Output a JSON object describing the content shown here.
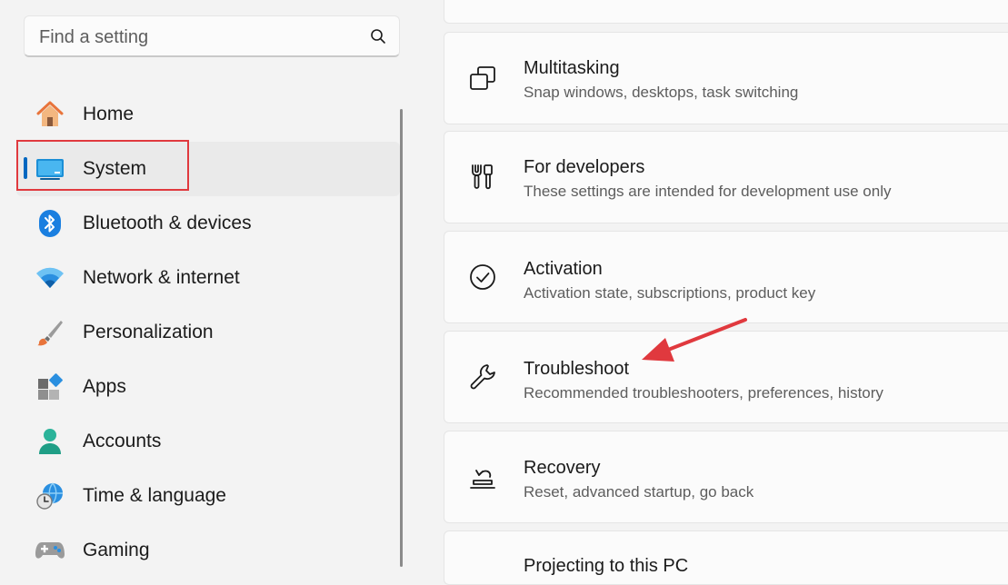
{
  "search": {
    "placeholder": "Find a setting"
  },
  "nav": {
    "items": [
      {
        "label": "Home"
      },
      {
        "label": "System"
      },
      {
        "label": "Bluetooth & devices"
      },
      {
        "label": "Network & internet"
      },
      {
        "label": "Personalization"
      },
      {
        "label": "Apps"
      },
      {
        "label": "Accounts"
      },
      {
        "label": "Time & language"
      },
      {
        "label": "Gaming"
      }
    ],
    "active_index": 1
  },
  "cards": [
    {
      "title": "Multitasking",
      "description": "Snap windows, desktops, task switching",
      "icon": "multitasking-icon"
    },
    {
      "title": "For developers",
      "description": "These settings are intended for development use only",
      "icon": "developer-tools-icon"
    },
    {
      "title": "Activation",
      "description": "Activation state, subscriptions, product key",
      "icon": "checkmark-circle-icon"
    },
    {
      "title": "Troubleshoot",
      "description": "Recommended troubleshooters, preferences, history",
      "icon": "wrench-icon"
    },
    {
      "title": "Recovery",
      "description": "Reset, advanced startup, go back",
      "icon": "recovery-icon"
    },
    {
      "title": "Projecting to this PC",
      "description": "",
      "icon": ""
    }
  ],
  "colors": {
    "accent": "#0067c0",
    "annotation": "#e0393e"
  }
}
